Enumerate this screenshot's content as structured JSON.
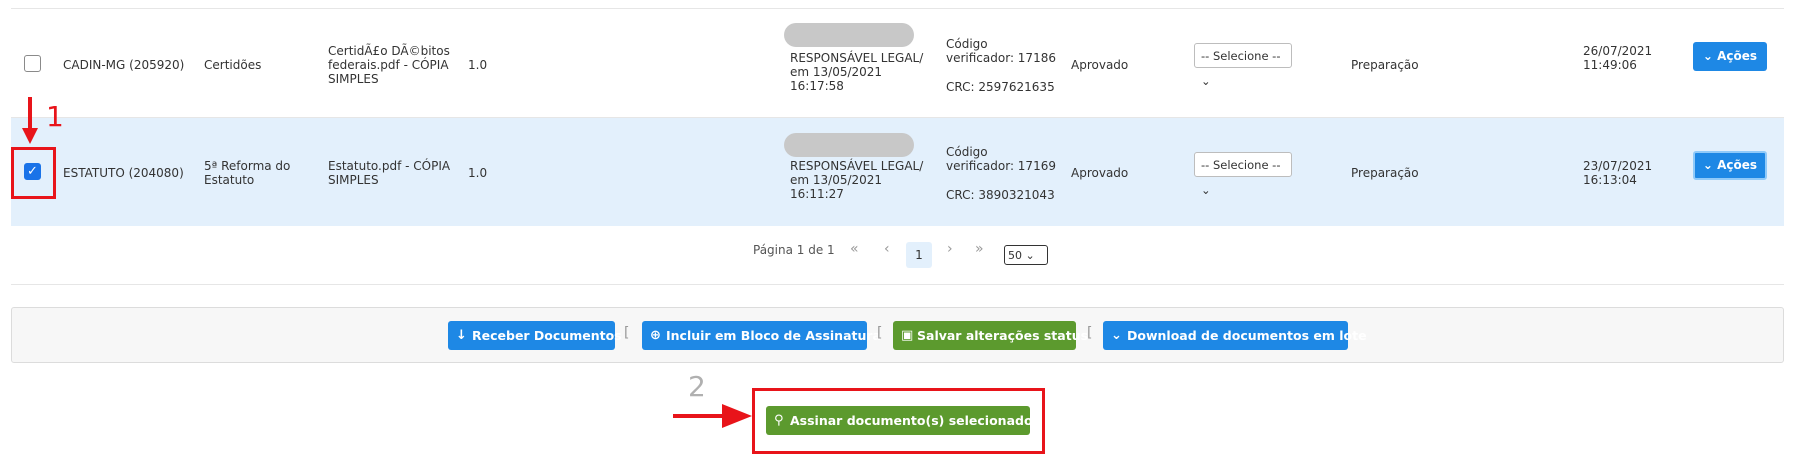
{
  "rows": [
    {
      "name": "CADIN-MG (205920)",
      "type": "Certidões",
      "file": [
        "CertidÃ£o DÃ©bitos",
        "federais.pdf - CÓPIA",
        "SIMPLES"
      ],
      "version": "1.0",
      "signer": [
        "RESPONSÁVEL LEGAL/",
        "em 13/05/2021",
        "16:17:58"
      ],
      "code": [
        "Código",
        "verificador: 17186"
      ],
      "crc": "CRC: 2597621635",
      "status": "Aprovado",
      "select": "-- Selecione --",
      "phase": "Preparação",
      "date": [
        "26/07/2021",
        "11:49:06"
      ],
      "action": "Ações",
      "checked": false
    },
    {
      "name": "ESTATUTO (204080)",
      "type": [
        "5ª Reforma do",
        "Estatuto"
      ],
      "file": [
        "Estatuto.pdf - CÓPIA",
        "SIMPLES"
      ],
      "version": "1.0",
      "signer": [
        "RESPONSÁVEL LEGAL/",
        "em 13/05/2021",
        "16:11:27"
      ],
      "code": [
        "Código",
        "verificador: 17169"
      ],
      "crc": "CRC: 3890321043",
      "status": "Aprovado",
      "select": "-- Selecione --",
      "phase": "Preparação",
      "date": [
        "23/07/2021",
        "16:13:04"
      ],
      "action": "Ações",
      "checked": true
    }
  ],
  "pagination": {
    "label": "Página 1 de 1",
    "first": "«",
    "prev": "‹",
    "current": "1",
    "next": "›",
    "last": "»",
    "page_size": "50"
  },
  "toolbar": {
    "receive": "Receber Documentos",
    "include": "Incluir em Bloco de Assinatura",
    "save": "Salvar alterações status",
    "download": "Download de documentos em lote",
    "sep": "["
  },
  "sign_button": "Assinar documento(s) selecionado(s)",
  "annotations": {
    "step1": "1",
    "step2": "2"
  },
  "colors": {
    "accent": "#1e88e5",
    "green": "#5c9a2e",
    "highlight": "#e3f0fc",
    "annotation_red": "#e8141a",
    "annotation_gray": "#b0b0b0"
  }
}
